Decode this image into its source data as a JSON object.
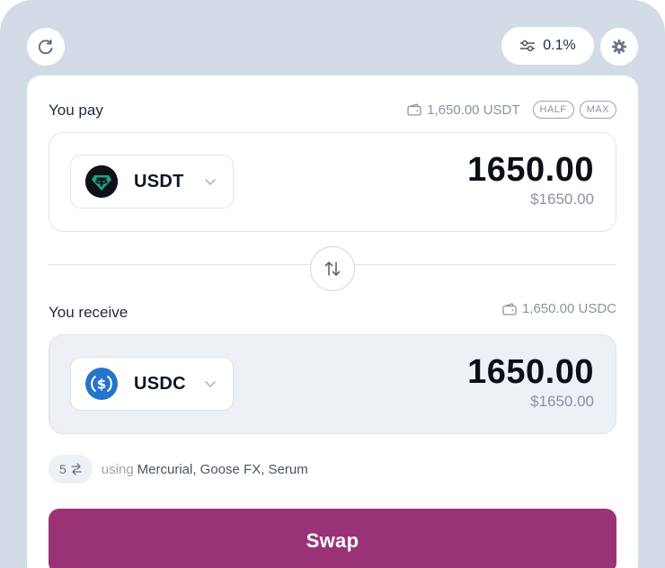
{
  "header": {
    "slippage_value": "0.1%"
  },
  "pay": {
    "label": "You pay",
    "balance": "1,650.00 USDT",
    "half_label": "HALF",
    "max_label": "MAX",
    "token": "USDT",
    "amount": "1650.00",
    "amount_usd": "$1650.00"
  },
  "receive": {
    "label": "You receive",
    "balance": "1,650.00 USDC",
    "token": "USDC",
    "amount": "1650.00",
    "amount_usd": "$1650.00"
  },
  "route": {
    "count": "5",
    "using_label": "using",
    "dexes": "Mercurial, Goose FX, Serum"
  },
  "swap_label": "Swap",
  "colors": {
    "accent": "#9a3376",
    "background": "#d3dce6",
    "usdt": "#1fa385",
    "usdc": "#2775ca"
  },
  "icons": {
    "refresh": "refresh-icon",
    "slippage": "sliders-icon",
    "settings": "gear-icon",
    "wallet": "wallet-icon",
    "switch": "swap-arrows-icon",
    "chevron": "chevron-down-icon",
    "route": "route-icon"
  }
}
